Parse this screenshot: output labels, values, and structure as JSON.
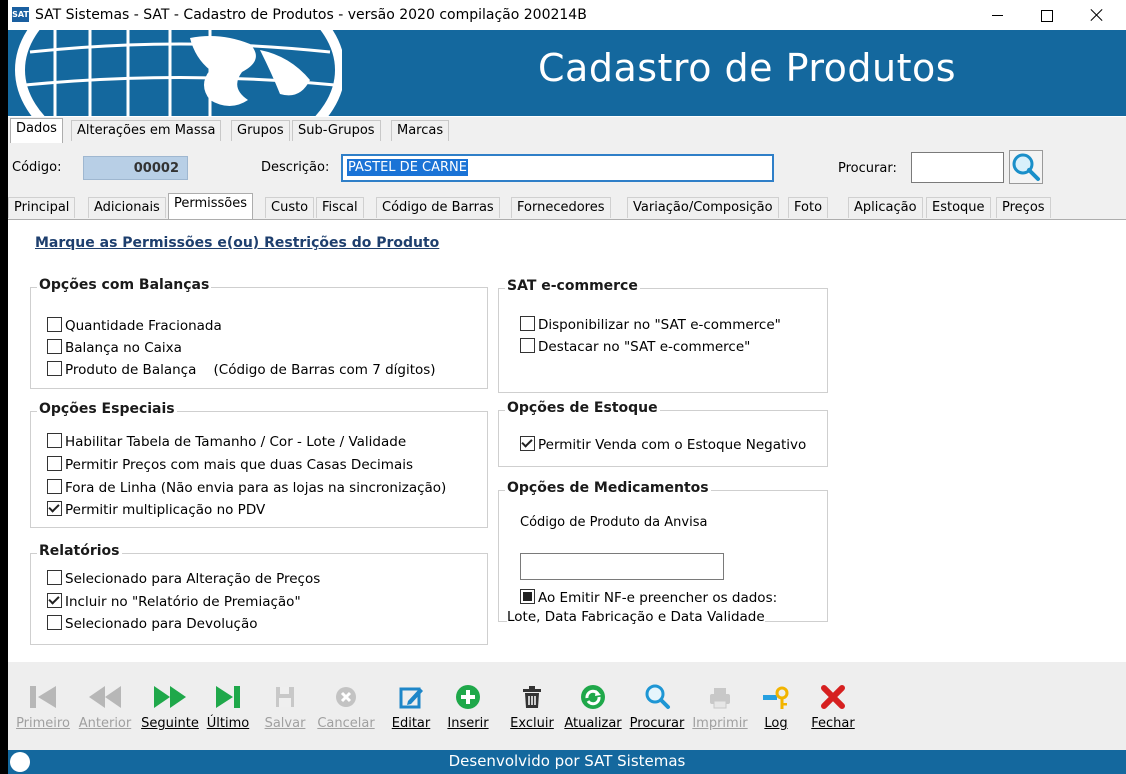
{
  "window": {
    "title": "SAT Sistemas - SAT - Cadastro de Produtos - versão 2020 compilação 200214B",
    "app_icon_text": "SAT"
  },
  "banner": {
    "title": "Cadastro de Produtos"
  },
  "top_tabs": [
    "Dados",
    "Alterações em Massa",
    "Grupos",
    "Sub-Grupos",
    "Marcas"
  ],
  "record": {
    "codigo_label": "Código:",
    "codigo_value": "00002",
    "descricao_label": "Descrição:",
    "descricao_value": "PASTEL DE CARNE",
    "procurar_label": "Procurar:"
  },
  "sub_tabs": [
    "Principal",
    "Adicionais",
    "Permissões",
    "Custo",
    "Fiscal",
    "Código de Barras",
    "Fornecedores",
    "Variação/Composição",
    "Foto",
    "Aplicação",
    "Estoque",
    "Preços"
  ],
  "permissoes": {
    "heading": "Marque as Permissões e(ou) Restrições do Produto",
    "balancas": {
      "title": "Opções com Balanças",
      "items": [
        {
          "label": "Quantidade Fracionada",
          "checked": false
        },
        {
          "label": "Balança no Caixa",
          "checked": false
        },
        {
          "label": "Produto de Balança    (Código de Barras com 7 dígitos)",
          "checked": false
        }
      ]
    },
    "especiais": {
      "title": "Opções Especiais",
      "items": [
        {
          "label": "Habilitar Tabela de Tamanho / Cor - Lote / Validade",
          "checked": false
        },
        {
          "label": "Permitir Preços com mais que duas Casas Decimais",
          "checked": false
        },
        {
          "label": "Fora de Linha (Não envia para as lojas na sincronização)",
          "checked": false
        },
        {
          "label": "Permitir multiplicação no PDV",
          "checked": true
        }
      ]
    },
    "relatorios": {
      "title": "Relatórios",
      "items": [
        {
          "label": "Selecionado para Alteração de Preços",
          "checked": false
        },
        {
          "label": "Incluir no \"Relatório de Premiação\"",
          "checked": true
        },
        {
          "label": "Selecionado para Devolução",
          "checked": false
        }
      ]
    },
    "ecommerce": {
      "title": "SAT e-commerce",
      "items": [
        {
          "label": "Disponibilizar no \"SAT e-commerce\"",
          "checked": false
        },
        {
          "label": "Destacar no \"SAT e-commerce\"",
          "checked": false
        }
      ]
    },
    "estoque": {
      "title": "Opções de Estoque",
      "items": [
        {
          "label": "Permitir Venda com o Estoque Negativo",
          "checked": true
        }
      ]
    },
    "medicamentos": {
      "title": "Opções de Medicamentos",
      "anvisa_label": "Código de Produto da Anvisa",
      "anvisa_value": "",
      "nfe_label": "Ao Emitir NF-e preencher os dados:",
      "nfe_label2": "Lote, Data Fabricação e Data Validade",
      "nfe_checked": true
    }
  },
  "toolbar": [
    {
      "label": "Primeiro",
      "icon": "first-icon",
      "enabled": false
    },
    {
      "label": "Anterior",
      "icon": "previous-icon",
      "enabled": false
    },
    {
      "label": "Seguinte",
      "icon": "next-icon",
      "enabled": true
    },
    {
      "label": "Último",
      "icon": "last-icon",
      "enabled": true
    },
    {
      "label": "Salvar",
      "icon": "save-icon",
      "enabled": false
    },
    {
      "label": "Cancelar",
      "icon": "cancel-icon",
      "enabled": false
    },
    {
      "label": "Editar",
      "icon": "edit-icon",
      "enabled": true
    },
    {
      "label": "Inserir",
      "icon": "add-icon",
      "enabled": true
    },
    {
      "label": "Excluir",
      "icon": "trash-icon",
      "enabled": true
    },
    {
      "label": "Atualizar",
      "icon": "refresh-icon",
      "enabled": true
    },
    {
      "label": "Procurar",
      "icon": "search-icon",
      "enabled": true
    },
    {
      "label": "Imprimir",
      "icon": "print-icon",
      "enabled": false
    },
    {
      "label": "Log",
      "icon": "key-icon",
      "enabled": true
    },
    {
      "label": "Fechar",
      "icon": "close-icon",
      "enabled": true
    }
  ],
  "status": {
    "text": "Desenvolvido por SAT Sistemas"
  },
  "colors": {
    "brand_blue": "#14689e",
    "selection": "#1a73d6",
    "green": "#1fa84a",
    "red": "#d62020"
  }
}
